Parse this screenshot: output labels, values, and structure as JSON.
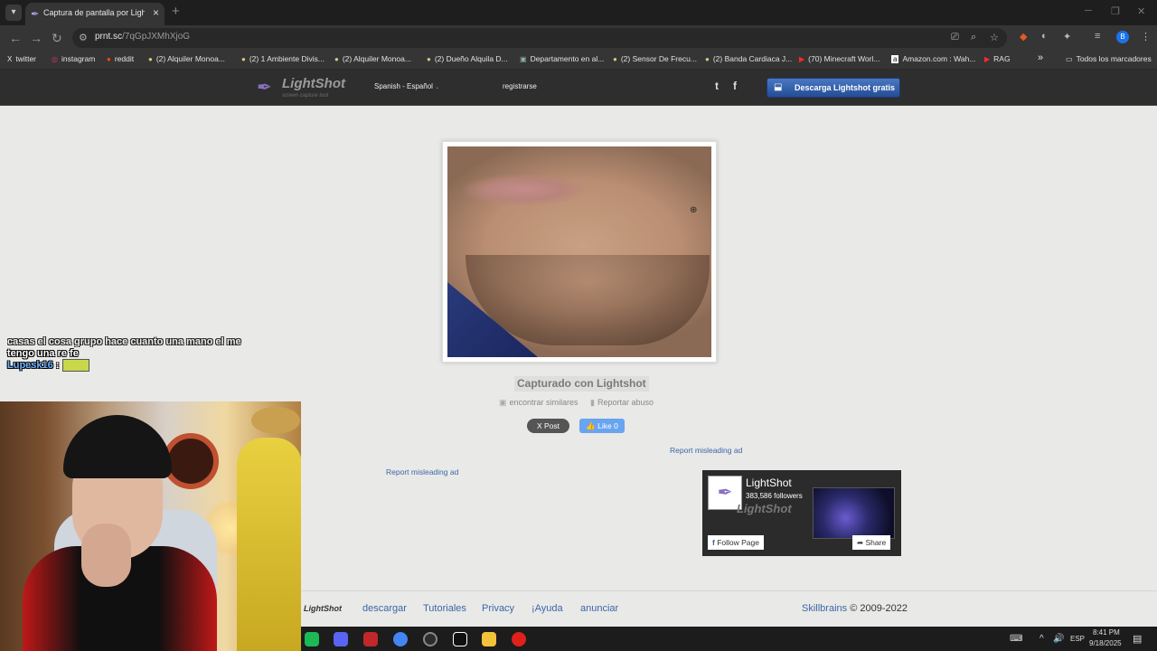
{
  "browser": {
    "tab_title": "Captura de pantalla por Lightshot",
    "new_tab_symbol": "+",
    "url_host": "prnt.sc",
    "url_path": "/7qGpJXMhXjoG",
    "profile_initial": "B",
    "bookmarks": [
      {
        "icon": "X",
        "label": "twitter"
      },
      {
        "icon": "◎",
        "label": "instagram"
      },
      {
        "icon": "●",
        "label": "reddit"
      },
      {
        "icon": "●",
        "label": "(2) Alquiler Monoa..."
      },
      {
        "icon": "●",
        "label": "(2) 1 Ambiente Divis..."
      },
      {
        "icon": "●",
        "label": "(2) Alquiler Monoa..."
      },
      {
        "icon": "●",
        "label": "(2) Dueño Alquila D..."
      },
      {
        "icon": "▣",
        "label": "Departamento en al..."
      },
      {
        "icon": "●",
        "label": "(2) Sensor De Frecu..."
      },
      {
        "icon": "●",
        "label": "(2) Banda Cardiaca J..."
      },
      {
        "icon": "▶",
        "label": "(70) Minecraft Worl..."
      },
      {
        "icon": "a",
        "label": "Amazon.com : Wah..."
      },
      {
        "icon": "▶",
        "label": "RAG"
      }
    ],
    "bookmarks_overflow": "»",
    "all_bookmarks": "Todos los marcadores"
  },
  "lightshot": {
    "logo_name": "LightShot",
    "logo_tagline": "screen capture tool",
    "language": "Spanish - Español",
    "register": "registrarse",
    "twitter": "t",
    "facebook": "f",
    "download_button": "Descarga Lightshot gratis",
    "captured_label": "Capturado con Lightshot",
    "find_similar": "encontrar similares",
    "report_abuse": "Reportar abuso",
    "x_post": "X Post",
    "fb_like": "Like 0",
    "report_ad_right": "Report misleading ad",
    "report_ad_left": "Report misleading ad",
    "fb_widget": {
      "page_name": "LightShot",
      "followers": "383,586 followers",
      "follow_button": "Follow Page",
      "share_button": "Share"
    },
    "footer": {
      "logo": "LightShot",
      "links": [
        "descargar",
        "Tutoriales",
        "Privacy",
        "¡Ayuda",
        "anunciar"
      ],
      "company": "Skillbrains",
      "copyright": "© 2009-2022"
    }
  },
  "stream_chat": {
    "faded_line": "casas el cosa grupo hace cuanto una mano el me",
    "message": "tengo una re fe",
    "username": "Lupesk16",
    "separator": ":"
  },
  "taskbar": {
    "language": "ESP",
    "time": "8:41 PM",
    "date": "9/18/2025",
    "pinned": [
      {
        "name": "spotify",
        "color": "#1db954"
      },
      {
        "name": "discord",
        "color": "#5865f2"
      },
      {
        "name": "game-app",
        "color": "#c0282a"
      },
      {
        "name": "chrome",
        "color": "#4285f4"
      },
      {
        "name": "obs",
        "color": "#2c2c2c"
      },
      {
        "name": "capcut",
        "color": "#111111"
      },
      {
        "name": "file-explorer",
        "color": "#f4c23a"
      },
      {
        "name": "opera",
        "color": "#e0201b"
      }
    ]
  },
  "colors": {
    "link_blue": "#3a67a8",
    "download_blue": "#2f5fb0",
    "page_bg": "#e9e9e7",
    "header_bg": "#2e2e2e"
  }
}
